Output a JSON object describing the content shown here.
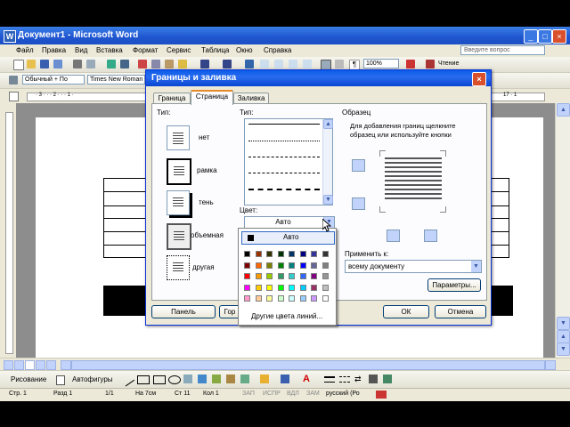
{
  "window": {
    "title": "Документ1 - Microsoft Word",
    "controls": [
      "_",
      "□",
      "×"
    ]
  },
  "menu": {
    "items": [
      "Файл",
      "Правка",
      "Вид",
      "Вставка",
      "Формат",
      "Сервис",
      "Таблица",
      "Окно",
      "Справка"
    ],
    "ask_placeholder": "Введите вопрос"
  },
  "toolbar": {
    "zoom": "100%",
    "read_label": "Чтение",
    "style_value": "Обычный + По",
    "font_value": "Times New Roman"
  },
  "ruler": {
    "left_marks": "· 3 · · · 2 · · · 1 ·",
    "right_marks": "17 · 1"
  },
  "drawbar": {
    "drawing_label": "Рисование",
    "autoshapes_label": "Автофигуры"
  },
  "status": {
    "page": "Стр. 1",
    "section": "Разд 1",
    "pages": "1/1",
    "at": "На 7см",
    "line": "Ст 11",
    "col": "Кол 1",
    "rec": "ЗАП",
    "trk": "ИСПР",
    "ext": "ВДЛ",
    "ovr": "ЗАМ",
    "language": "русский (Ро"
  },
  "dialog": {
    "title": "Границы и заливка",
    "tabs": [
      "Граница",
      "Страница",
      "Заливка"
    ],
    "active_tab": "Страница",
    "type_label": "Тип:",
    "types": [
      "нет",
      "рамка",
      "тень",
      "объемная",
      "другая"
    ],
    "style_label": "Тип:",
    "color_label": "Цвет:",
    "color_value": "Авто",
    "preview_label": "Образец",
    "preview_hint_1": "Для добавления границ щелкните",
    "preview_hint_2": "образец или используйте кнопки",
    "apply_label": "Применить к:",
    "apply_value": "всему документу",
    "options_button": "Параметры...",
    "panel_button": "Панель",
    "horizontal_button": "Гор",
    "ok_button": "ОК",
    "cancel_button": "Отмена"
  },
  "palette": {
    "auto_label": "Авто",
    "more_label": "Другие цвета линий...",
    "colors": [
      [
        "#000000",
        "#993300",
        "#333300",
        "#003300",
        "#003366",
        "#000080",
        "#333399",
        "#333333"
      ],
      [
        "#800000",
        "#FF6600",
        "#808000",
        "#008000",
        "#008080",
        "#0000FF",
        "#666699",
        "#808080"
      ],
      [
        "#FF0000",
        "#FF9900",
        "#99CC00",
        "#339966",
        "#33CCCC",
        "#3366FF",
        "#800080",
        "#969696"
      ],
      [
        "#FF00FF",
        "#FFCC00",
        "#FFFF00",
        "#00FF00",
        "#00FFFF",
        "#00CCFF",
        "#993366",
        "#C0C0C0"
      ],
      [
        "#FF99CC",
        "#FFCC99",
        "#FFFF99",
        "#CCFFCC",
        "#CCFFFF",
        "#99CCFF",
        "#CC99FF",
        "#FFFFFF"
      ]
    ]
  }
}
